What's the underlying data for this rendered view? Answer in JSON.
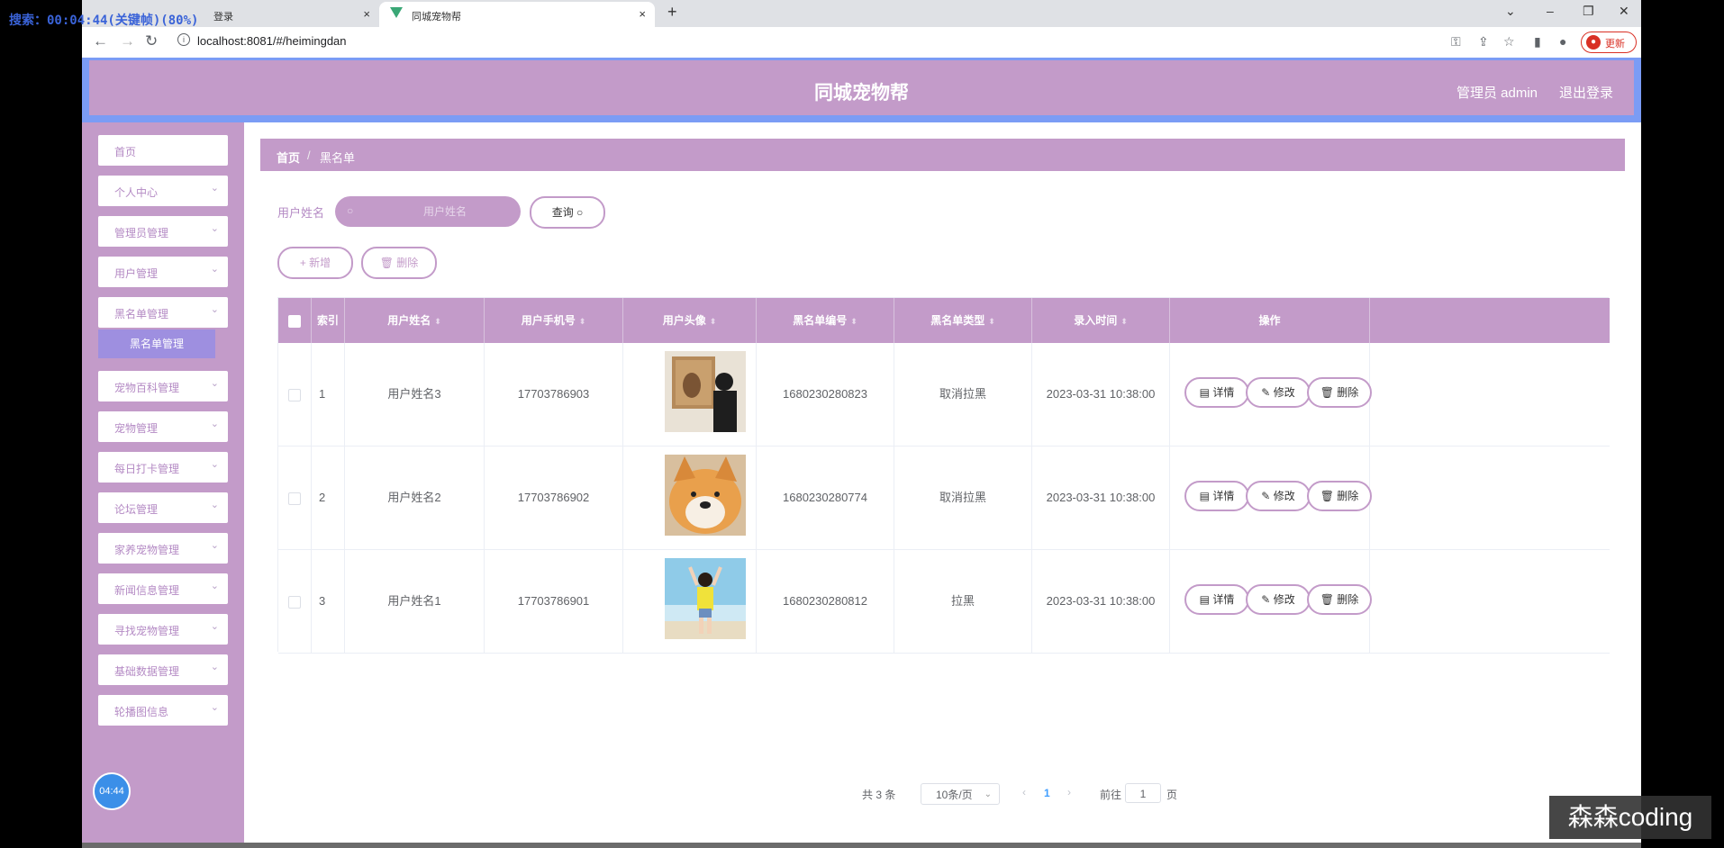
{
  "overlay": {
    "search_text": "搜索：00:04:44(关键帧)(80%)"
  },
  "browser": {
    "tabs": [
      {
        "label": "登录",
        "close": "×"
      },
      {
        "label": "同城宠物帮",
        "close": "×"
      }
    ],
    "new_tab": "+",
    "url": "localhost:8081/#/heimingdan",
    "update_label": "更新"
  },
  "header": {
    "site_title": "同城宠物帮",
    "admin_label": "管理员 admin",
    "logout_label": "退出登录"
  },
  "sidebar": {
    "items": [
      {
        "label": "首页",
        "expandable": false
      },
      {
        "label": "个人中心",
        "expandable": true
      },
      {
        "label": "管理员管理",
        "expandable": true
      },
      {
        "label": "用户管理",
        "expandable": true
      },
      {
        "label": "黑名单管理",
        "expandable": true
      },
      {
        "label": "宠物百科管理",
        "expandable": true
      },
      {
        "label": "宠物管理",
        "expandable": true
      },
      {
        "label": "每日打卡管理",
        "expandable": true
      },
      {
        "label": "论坛管理",
        "expandable": true
      },
      {
        "label": "家养宠物管理",
        "expandable": true
      },
      {
        "label": "新闻信息管理",
        "expandable": true
      },
      {
        "label": "寻找宠物管理",
        "expandable": true
      },
      {
        "label": "基础数据管理",
        "expandable": true
      },
      {
        "label": "轮播图信息",
        "expandable": true
      }
    ],
    "active_submenu": "黑名单管理",
    "timer": "04:44"
  },
  "breadcrumb": {
    "home": "首页",
    "separator": "/",
    "current": "黑名单"
  },
  "search": {
    "label": "用户姓名",
    "placeholder": "用户姓名",
    "query_button": "查询"
  },
  "actions": {
    "add": "新增",
    "delete": "删除"
  },
  "table": {
    "columns": [
      "索引",
      "用户姓名",
      "用户手机号",
      "用户头像",
      "黑名单编号",
      "黑名单类型",
      "录入时间",
      "操作"
    ],
    "rows": [
      {
        "index": "1",
        "name": "用户姓名3",
        "phone": "17703786903",
        "avatar": "photo-person-art",
        "code": "1680230280823",
        "type": "取消拉黑",
        "time": "2023-03-31 10:38:00"
      },
      {
        "index": "2",
        "name": "用户姓名2",
        "phone": "17703786902",
        "avatar": "photo-shiba-dog",
        "code": "1680230280774",
        "type": "取消拉黑",
        "time": "2023-03-31 10:38:00"
      },
      {
        "index": "3",
        "name": "用户姓名1",
        "phone": "17703786901",
        "avatar": "photo-girl-beach",
        "code": "1680230280812",
        "type": "拉黑",
        "time": "2023-03-31 10:38:00"
      }
    ],
    "ops": {
      "detail": "详情",
      "edit": "修改",
      "delete": "删除"
    }
  },
  "pagination": {
    "total": "共 3 条",
    "page_size": "10条/页",
    "current_page": "1",
    "goto_label": "前往",
    "goto_value": "1",
    "page_unit": "页"
  },
  "watermark": "森森coding",
  "colors": {
    "theme": "#c39bc9",
    "header_border": "#7b9cf5",
    "active_sub": "#9e8fe0"
  }
}
